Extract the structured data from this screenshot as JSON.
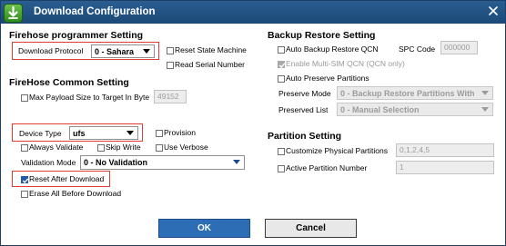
{
  "window": {
    "title": "Download Configuration",
    "close_glyph": "✕"
  },
  "firehose_programmer": {
    "heading": "Firehose programmer Setting",
    "download_protocol_label": "Download Protocol",
    "download_protocol_value": "0 - Sahara",
    "reset_state_machine": {
      "label": "Reset State Machine",
      "checked": false
    },
    "read_serial_number": {
      "label": "Read Serial Number",
      "checked": false
    }
  },
  "firehose_common": {
    "heading": "FireHose Common Setting",
    "max_payload": {
      "label": "Max Payload Size to Target In Byte",
      "checked": false,
      "value": "49152"
    },
    "device_type_label": "Device Type",
    "device_type_value": "ufs",
    "provision": {
      "label": "Provision",
      "checked": false
    },
    "always_validate": {
      "label": "Always Validate",
      "checked": false
    },
    "skip_write": {
      "label": "Skip Write",
      "checked": false
    },
    "use_verbose": {
      "label": "Use Verbose",
      "checked": false
    },
    "validation_mode_label": "Validation Mode",
    "validation_mode_value": "0 - No Validation",
    "reset_after_download": {
      "label": "Reset After Download",
      "checked": true
    },
    "erase_all_before_download": {
      "label": "Erase All Before Download",
      "checked": false
    }
  },
  "backup_restore": {
    "heading": "Backup Restore Setting",
    "auto_backup_restore_qcn": {
      "label": "Auto Backup Restore QCN",
      "checked": false
    },
    "spc_code_label": "SPC Code",
    "spc_code_value": "000000",
    "enable_multi_sim_qcn": {
      "label": "Enable Multi-SIM QCN (QCN only)",
      "checked": true,
      "disabled": true
    },
    "auto_preserve_partitions": {
      "label": "Auto Preserve Partitions",
      "checked": false
    },
    "preserve_mode_label": "Preserve Mode",
    "preserve_mode_value": "0 - Backup Restore Partitions With",
    "preserved_list_label": "Preserved List",
    "preserved_list_value": "0 - Manual Selection"
  },
  "partition": {
    "heading": "Partition Setting",
    "customize_physical_partitions": {
      "label": "Customize Physical Partitions",
      "checked": false,
      "value": "0,1,2,4,5"
    },
    "active_partition_number": {
      "label": "Active Partition Number",
      "checked": false,
      "value": "1"
    }
  },
  "buttons": {
    "ok": "OK",
    "cancel": "Cancel"
  },
  "colors": {
    "titlebar": "#1c4a78",
    "ok_button": "#2c6db5",
    "highlight": "#e03c31",
    "checkbox_checked": "#1e5aa8"
  },
  "icons": {
    "app": "download-arrow-icon",
    "close": "close-icon",
    "dropdown": "chevron-down-icon",
    "check": "checkmark-icon"
  }
}
